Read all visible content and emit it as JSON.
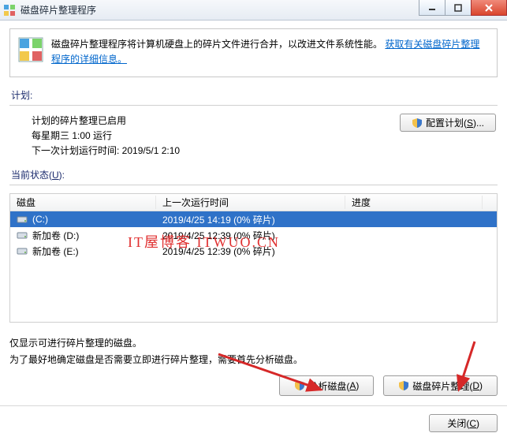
{
  "window": {
    "title": "磁盘碎片整理程序"
  },
  "info": {
    "text": "磁盘碎片整理程序将计算机硬盘上的碎片文件进行合并，以改进文件系统性能。",
    "link": "获取有关磁盘碎片整理程序的详细信息。"
  },
  "labels": {
    "schedule": "计划:",
    "status": "当前状态(",
    "status_key": "U",
    "status_after": "):"
  },
  "schedule": {
    "enabled": "计划的碎片整理已启用",
    "freq": "每星期三   1:00 运行",
    "next": "下一次计划运行时间: 2019/5/1 2:10"
  },
  "buttons": {
    "config_pre": "配置计划(",
    "config_key": "S",
    "config_post": ")...",
    "analyze_pre": "分析磁盘(",
    "analyze_key": "A",
    "analyze_post": ")",
    "defrag_pre": "磁盘碎片整理(",
    "defrag_key": "D",
    "defrag_post": ")",
    "close_pre": "关闭(",
    "close_key": "C",
    "close_post": ")"
  },
  "columns": {
    "disk": "磁盘",
    "last": "上一次运行时间",
    "progress": "进度"
  },
  "rows": [
    {
      "name": "(C:)",
      "last": "2019/4/25 14:19 (0% 碎片)",
      "selected": true
    },
    {
      "name": "新加卷 (D:)",
      "last": "2019/4/25 12:39 (0% 碎片)",
      "selected": false
    },
    {
      "name": "新加卷 (E:)",
      "last": "2019/4/25 12:39 (0% 碎片)",
      "selected": false
    }
  ],
  "note": {
    "l1": "仅显示可进行碎片整理的磁盘。",
    "l2": "为了最好地确定磁盘是否需要立即进行碎片整理，需要首先分析磁盘。"
  },
  "watermark": "IT屋博客  ITWUO.CN"
}
